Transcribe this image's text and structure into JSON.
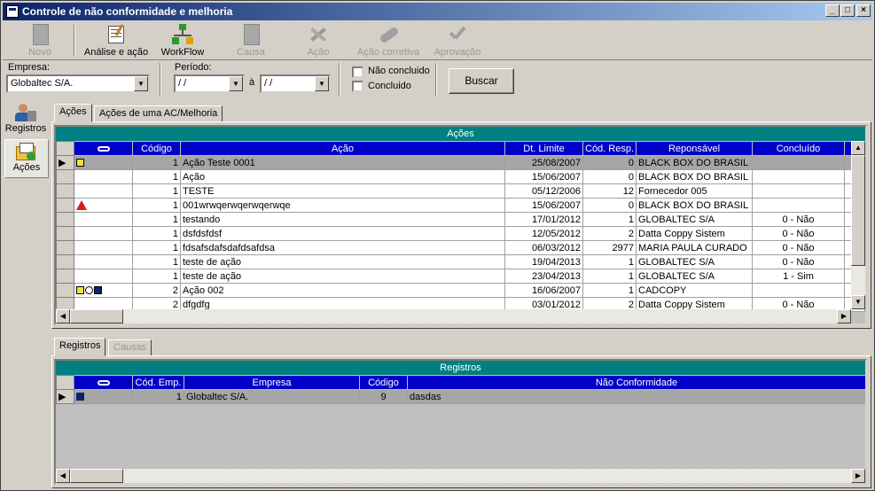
{
  "window": {
    "title": "Controle de não conformidade e melhoria",
    "minimize": "_",
    "maximize": "□",
    "close": "×"
  },
  "toolbar": {
    "novo": "Novo",
    "analise": "Análise e ação",
    "workflow": "WorkFlow",
    "causa": "Causa",
    "acao": "Ação",
    "acao_corretiva": "Ação corretiva",
    "aprovacao": "Aprovação"
  },
  "filters": {
    "empresa_label": "Empresa:",
    "empresa_value": "Globaltec S/A.",
    "periodo_label": "Período:",
    "date_from": " / /",
    "a_label": "à",
    "date_to": " / /",
    "nao_concluido_label": "Não concluido",
    "concluido_label": "Concluido",
    "buscar": "Buscar"
  },
  "leftnav": {
    "registros": "Registros",
    "acoes": "Ações"
  },
  "top_tabs": {
    "acoes": "Ações",
    "acoes_ac": "Ações de uma AC/Melhoria"
  },
  "acoes_grid": {
    "title": "Ações",
    "headers": [
      "Código",
      "Ação",
      "Dt. Limite",
      "Cód. Resp.",
      "Reponsável",
      "Concluído"
    ],
    "rows": [
      {
        "codigo": "1",
        "acao": "Ação Teste 0001",
        "dt": "25/08/2007",
        "resp": "0",
        "responsavel": "BLACK BOX DO BRASIL",
        "concluido": ""
      },
      {
        "codigo": "1",
        "acao": "Ação",
        "dt": "15/06/2007",
        "resp": "0",
        "responsavel": "BLACK BOX DO BRASIL",
        "concluido": ""
      },
      {
        "codigo": "1",
        "acao": "TESTE",
        "dt": "05/12/2006",
        "resp": "12",
        "responsavel": "Fornecedor 005",
        "concluido": ""
      },
      {
        "codigo": "1",
        "acao": "001wrwqerwqerwqerwqe",
        "dt": "15/06/2007",
        "resp": "0",
        "responsavel": "BLACK BOX DO BRASIL",
        "concluido": ""
      },
      {
        "codigo": "1",
        "acao": "testando",
        "dt": "17/01/2012",
        "resp": "1",
        "responsavel": "GLOBALTEC S/A",
        "concluido": "0 - Não"
      },
      {
        "codigo": "1",
        "acao": "dsfdsfdsf",
        "dt": "12/05/2012",
        "resp": "2",
        "responsavel": "Datta Coppy Sistem",
        "concluido": "0 - Não"
      },
      {
        "codigo": "1",
        "acao": "fdsafsdafsdafdsafdsa",
        "dt": "06/03/2012",
        "resp": "2977",
        "responsavel": "MARIA PAULA CURADO",
        "concluido": "0 - Não"
      },
      {
        "codigo": "1",
        "acao": "teste de ação",
        "dt": "19/04/2013",
        "resp": "1",
        "responsavel": "GLOBALTEC S/A",
        "concluido": "0 - Não"
      },
      {
        "codigo": "1",
        "acao": "teste de ação",
        "dt": "23/04/2013",
        "resp": "1",
        "responsavel": "GLOBALTEC S/A",
        "concluido": "1 - Sim"
      },
      {
        "codigo": "2",
        "acao": "Ação 002",
        "dt": "16/06/2007",
        "resp": "1",
        "responsavel": "CADCOPY",
        "concluido": ""
      },
      {
        "codigo": "2",
        "acao": "dfgdfg",
        "dt": "03/01/2012",
        "resp": "2",
        "responsavel": "Datta Coppy Sistem",
        "concluido": "0 - Não"
      }
    ]
  },
  "bottom_tabs": {
    "registros": "Registros",
    "causas": "Causas"
  },
  "registros_grid": {
    "title": "Registros",
    "headers": [
      "Cód. Emp.",
      "Empresa",
      "Código",
      "Não Conformidade"
    ],
    "rows": [
      {
        "cod_emp": "1",
        "empresa": "Globaltec S/A.",
        "codigo": "9",
        "nao_conformidade": "dasdas"
      }
    ]
  },
  "icons": {
    "paperclip": "paperclip-icon",
    "note": "note-icon",
    "warning": "warning-icon",
    "clock": "clock-icon",
    "camera": "camera-icon"
  },
  "colors": {
    "grid_header": "#0000c8",
    "grid_title": "#008080",
    "titlebar": "#0a246a"
  }
}
